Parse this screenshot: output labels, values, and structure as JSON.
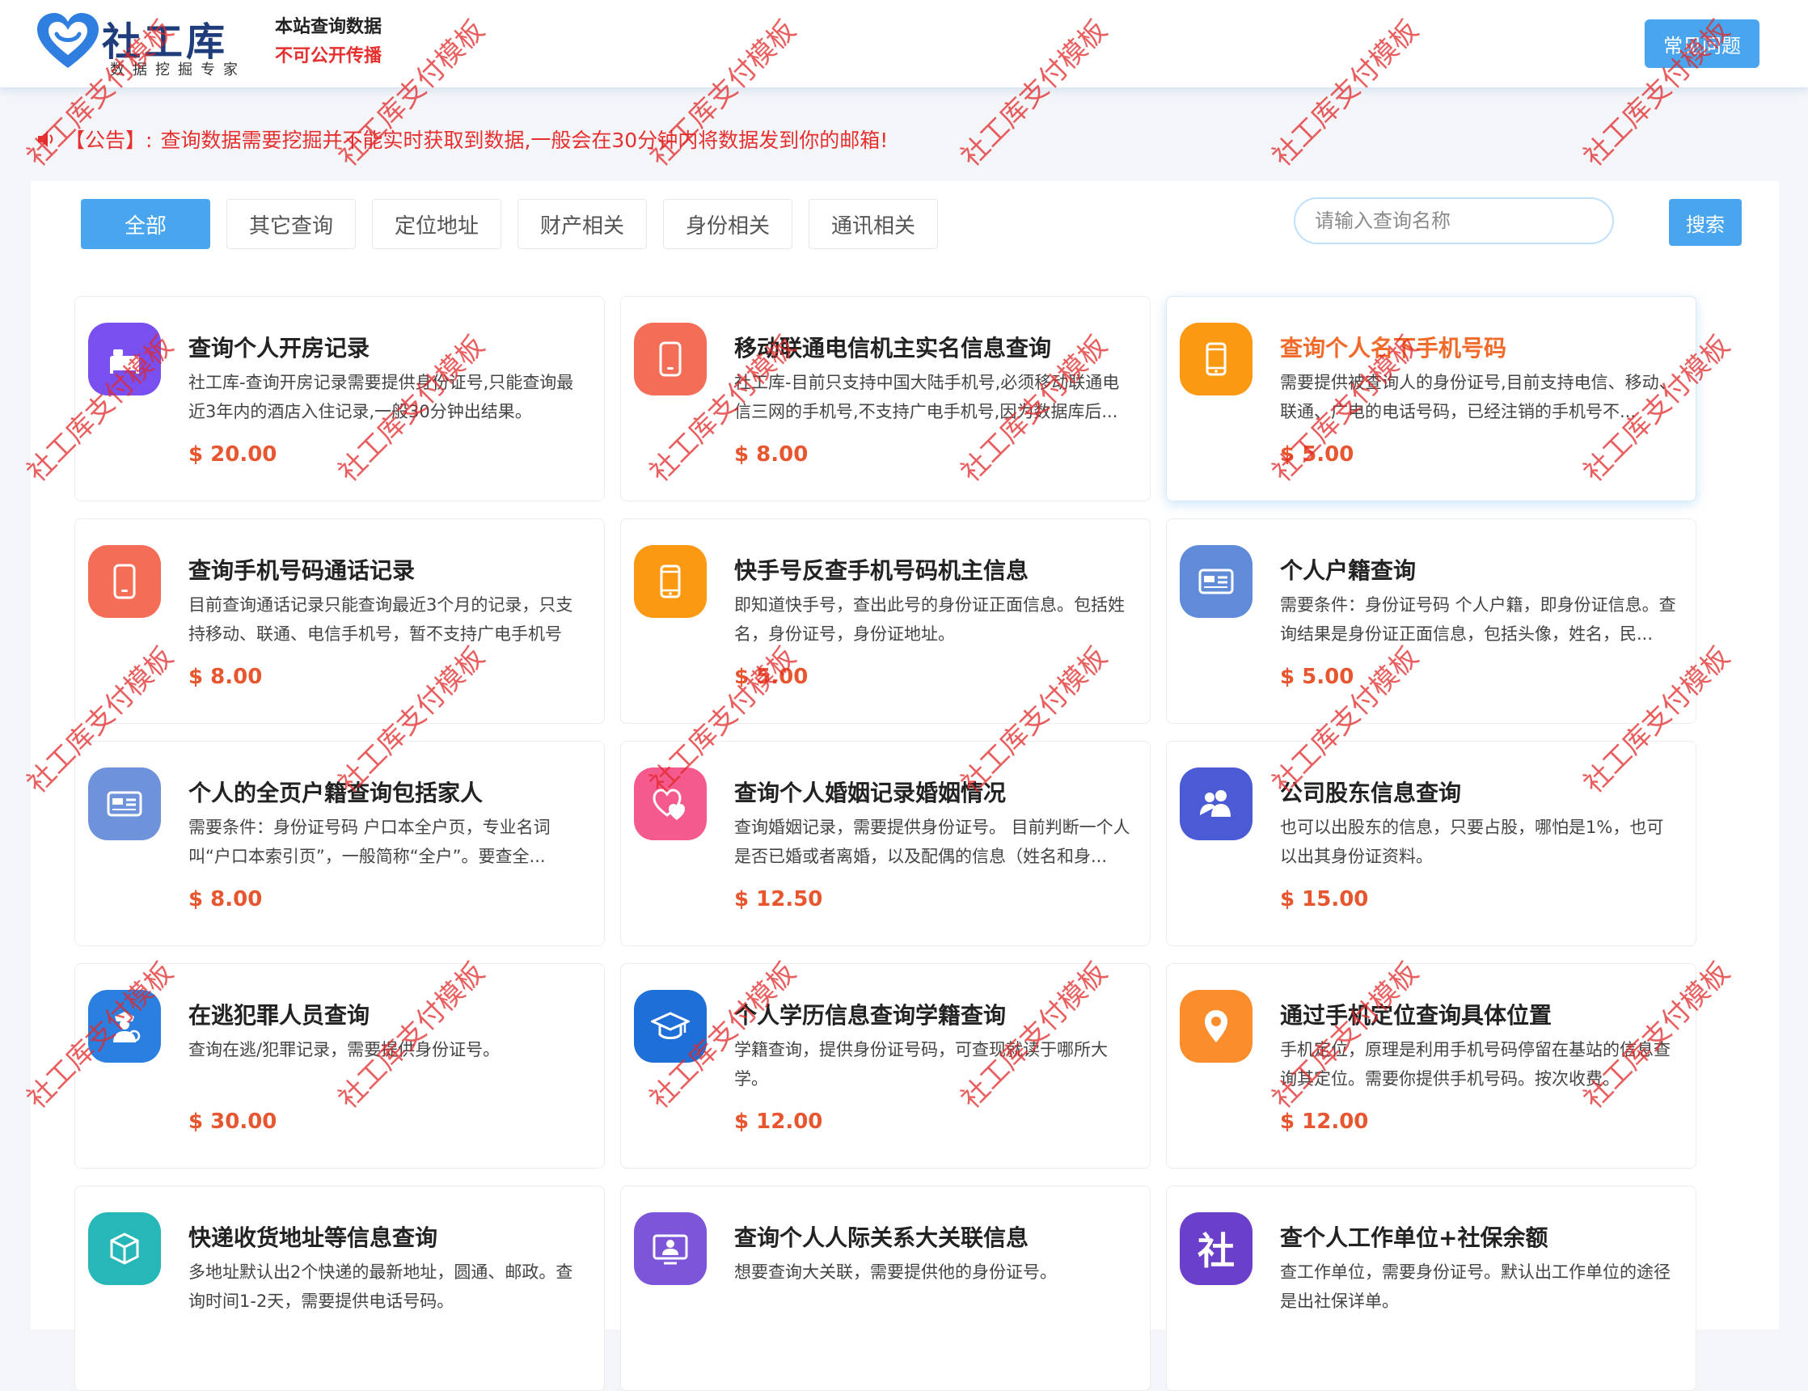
{
  "header": {
    "logo_title": "社工库",
    "logo_sub": "数据挖掘专家",
    "note_line1": "本站查询数据",
    "note_line2": "不可公开传播",
    "faq_label": "常见问题"
  },
  "notice": {
    "tag": "【公告】:",
    "text": "查询数据需要挖掘并不能实时获取到数据,一般会在30分钟内将数据发到你的邮箱!"
  },
  "tabs": [
    "全部",
    "其它查询",
    "定位地址",
    "财产相关",
    "身份相关",
    "通讯相关"
  ],
  "search": {
    "placeholder": "请输入查询名称",
    "button": "搜索"
  },
  "cards": [
    {
      "title": "查询个人开房记录",
      "desc": "社工库-查询开房记录需要提供身份证号,只能查询最近3年内的酒店入住记录,一般30分钟出结果。",
      "price": "$ 20.00",
      "icon": "hotel-icon",
      "color": "#7a4ff0"
    },
    {
      "title": "移动联通电信机主实名信息查询",
      "desc": "社工库-目前只支持中国大陆手机号,必须移动联通电信三网的手机号,不支持广电手机号,因为数据库后...",
      "price": "$ 8.00",
      "icon": "phone-icon",
      "color": "#f46e57"
    },
    {
      "title": "查询个人名下手机号码",
      "desc": "需要提供被查询人的身份证号,目前支持电信、移动、联通、广电的电话号码，已经注销的手机号不...",
      "price": "$ 5.00",
      "icon": "mobile-icon",
      "color": "#fb9a12"
    },
    {
      "title": "查询手机号码通话记录",
      "desc": "目前查询通话记录只能查询最近3个月的记录，只支持移动、联通、电信手机号，暂不支持广电手机号",
      "price": "$ 8.00",
      "icon": "phone-icon",
      "color": "#f46e57"
    },
    {
      "title": "快手号反查手机号码机主信息",
      "desc": "即知道快手号，查出此号的身份证正面信息。包括姓名，身份证号，身份证地址。",
      "price": "$ 5.00",
      "icon": "mobile-icon",
      "color": "#fb9a12"
    },
    {
      "title": "个人户籍查询",
      "desc": "需要条件：身份证号码 个人户籍，即身份证信息。查询结果是身份证正面信息，包括头像，姓名，民...",
      "price": "$ 5.00",
      "icon": "id-card-icon",
      "color": "#5f8bd8"
    },
    {
      "title": "个人的全页户籍查询包括家人",
      "desc": "需要条件：身份证号码 户口本全户页，专业名词叫“户口本索引页”，一般简称“全户”。要查全...",
      "price": "$ 8.00",
      "icon": "id-card-icon",
      "color": "#6f93da"
    },
    {
      "title": "查询个人婚姻记录婚姻情况",
      "desc": "查询婚姻记录，需要提供身份证号。 目前判断一个人是否已婚或者离婚，以及配偶的信息（姓名和身...",
      "price": "$ 12.50",
      "icon": "hearts-icon",
      "color": "#f55a8e"
    },
    {
      "title": "公司股东信息查询",
      "desc": "也可以出股东的信息，只要占股，哪怕是1%，也可以出其身份证资料。",
      "price": "$ 15.00",
      "icon": "shareholder-icon",
      "color": "#4b5bd6"
    },
    {
      "title": "在逃犯罪人员查询",
      "desc": "查询在逃/犯罪记录，需要提供身份证号。",
      "price": "$ 30.00",
      "icon": "police-icon",
      "color": "#2a7fe0"
    },
    {
      "title": "个人学历信息查询学籍查询",
      "desc": "学籍查询，提供身份证号码，可查现就读于哪所大学。",
      "price": "$ 12.00",
      "icon": "graduation-cap-icon",
      "color": "#1f6fd8"
    },
    {
      "title": "通过手机定位查询具体位置",
      "desc": "手机定位，原理是利用手机号码停留在基站的信息查询其定位。需要你提供手机号码。按次收费。",
      "price": "$ 12.00",
      "icon": "location-pin-icon",
      "color": "#fb8d2c"
    },
    {
      "title": "快递收货地址等信息查询",
      "desc": "多地址默认出2个快递的最新地址，圆通、邮政。查询时间1-2天，需要提供电话号码。",
      "price": "",
      "icon": "package-icon",
      "color": "#27b7b8"
    },
    {
      "title": "查询个人人际关系大关联信息",
      "desc": "想要查询大关联，需要提供他的身份证号。",
      "price": "",
      "icon": "profile-screen-icon",
      "color": "#7d55d9"
    },
    {
      "title": "查个人工作单位+社保余额",
      "desc": "查工作单位，需要身份证号。默认出工作单位的途径是出社保详单。",
      "price": "",
      "icon": "she-icon",
      "color": "#6a3fc9"
    }
  ],
  "watermark": "社工库支付模板"
}
